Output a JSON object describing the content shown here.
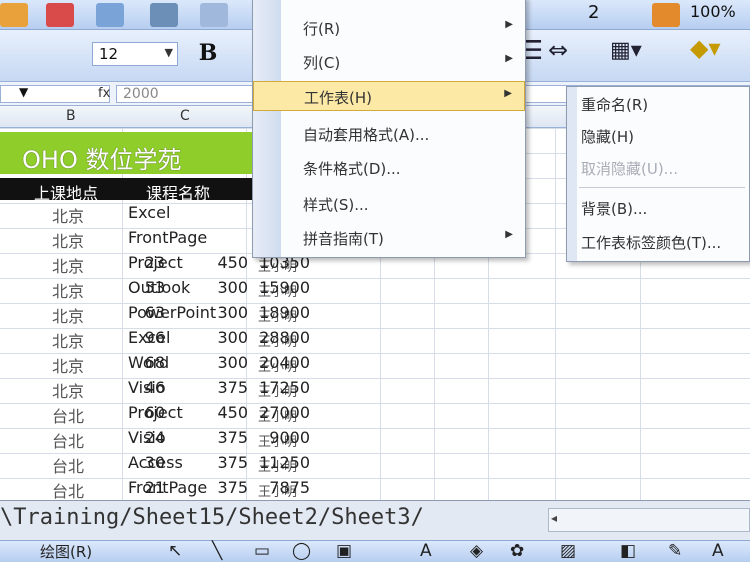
{
  "toolbar": {
    "font_size": "12",
    "bold_label": "B",
    "zoom_text": "100%",
    "count_text": "2"
  },
  "formula_bar": {
    "fx_label": "fx",
    "value": "2000"
  },
  "column_headers": [
    "B",
    "C"
  ],
  "sheet": {
    "title": "OHO 数位学苑",
    "headers": [
      "上课地点",
      "课程名称"
    ],
    "rows": [
      {
        "location": "北京",
        "course": "Excel",
        "instructor": "",
        "n1": "",
        "n2": "",
        "n3": ""
      },
      {
        "location": "北京",
        "course": "FrontPage",
        "instructor": "",
        "n1": "",
        "n2": "",
        "n3": ""
      },
      {
        "location": "北京",
        "course": "Project",
        "instructor": "王小明",
        "n1": "23",
        "n2": "450",
        "n3": "10350"
      },
      {
        "location": "北京",
        "course": "Outlook",
        "instructor": "王小明",
        "n1": "53",
        "n2": "300",
        "n3": "15900"
      },
      {
        "location": "北京",
        "course": "PowerPoint",
        "instructor": "王小明",
        "n1": "63",
        "n2": "300",
        "n3": "18900"
      },
      {
        "location": "北京",
        "course": "Excel",
        "instructor": "王小明",
        "n1": "96",
        "n2": "300",
        "n3": "28800"
      },
      {
        "location": "北京",
        "course": "Word",
        "instructor": "王小明",
        "n1": "68",
        "n2": "300",
        "n3": "20400"
      },
      {
        "location": "北京",
        "course": "Visio",
        "instructor": "王小明",
        "n1": "46",
        "n2": "375",
        "n3": "17250"
      },
      {
        "location": "台北",
        "course": "Project",
        "instructor": "王小明",
        "n1": "60",
        "n2": "450",
        "n3": "27000"
      },
      {
        "location": "台北",
        "course": "Visio",
        "instructor": "王小明",
        "n1": "24",
        "n2": "375",
        "n3": "9000"
      },
      {
        "location": "台北",
        "course": "Access",
        "instructor": "王小明",
        "n1": "30",
        "n2": "375",
        "n3": "11250"
      },
      {
        "location": "台北",
        "course": "FrontPage",
        "instructor": "王小明",
        "n1": "21",
        "n2": "375",
        "n3": "7875"
      }
    ]
  },
  "format_menu": {
    "items": [
      {
        "label": "行(R)",
        "submenu": true
      },
      {
        "label": "列(C)",
        "submenu": true
      },
      {
        "label": "工作表(H)",
        "submenu": true,
        "highlighted": true
      },
      {
        "label": "自动套用格式(A)...",
        "submenu": false
      },
      {
        "label": "条件格式(D)...",
        "submenu": false
      },
      {
        "label": "样式(S)...",
        "submenu": false
      },
      {
        "label": "拼音指南(T)",
        "submenu": true
      }
    ]
  },
  "sheet_submenu": {
    "items": [
      {
        "label": "重命名(R)",
        "disabled": false
      },
      {
        "label": "隐藏(H)",
        "disabled": false
      },
      {
        "label": "取消隐藏(U)...",
        "disabled": true
      },
      {
        "label": "背景(B)...",
        "disabled": false
      },
      {
        "label": "工作表标签颜色(T)...",
        "disabled": false
      }
    ]
  },
  "sheet_tabs": {
    "path": "\\Training/Sheet15/Sheet2/Sheet3/"
  },
  "draw_toolbar": {
    "label": "绘图(R)"
  }
}
